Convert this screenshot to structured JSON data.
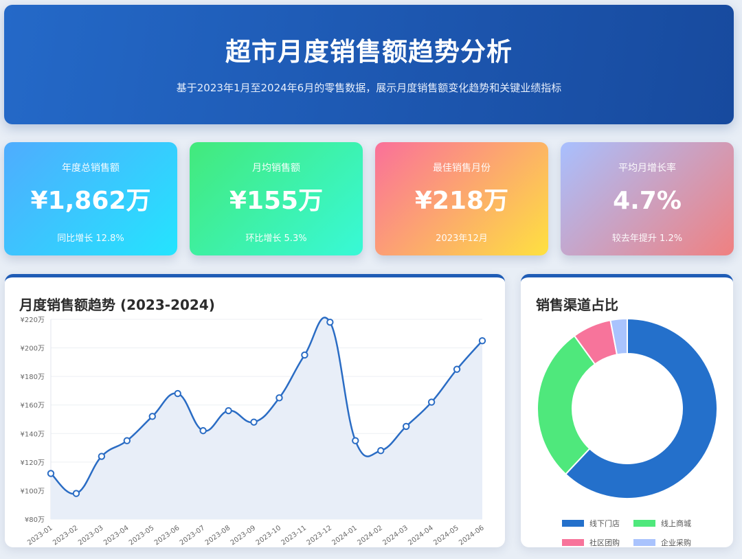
{
  "header": {
    "title": "超市月度销售额趋势分析",
    "subtitle": "基于2023年1月至2024年6月的零售数据，展示月度销售额变化趋势和关键业绩指标"
  },
  "cards": [
    {
      "label": "年度总销售额",
      "value": "¥1,862万",
      "sub": "同比增长 12.8%"
    },
    {
      "label": "月均销售额",
      "value": "¥155万",
      "sub": "环比增长 5.3%"
    },
    {
      "label": "最佳销售月份",
      "value": "¥218万",
      "sub": "2023年12月"
    },
    {
      "label": "平均月增长率",
      "value": "4.7%",
      "sub": "较去年提升 1.2%"
    }
  ],
  "line_panel": {
    "title": "月度销售额趋势 (2023-2024)"
  },
  "pie_panel": {
    "title": "销售渠道占比"
  },
  "chart_data": [
    {
      "type": "line",
      "title": "月度销售额趋势 (2023-2024)",
      "x": [
        "2023-01",
        "2023-02",
        "2023-03",
        "2023-04",
        "2023-05",
        "2023-06",
        "2023-07",
        "2023-08",
        "2023-09",
        "2023-10",
        "2023-11",
        "2023-12",
        "2024-01",
        "2024-02",
        "2024-03",
        "2024-04",
        "2024-05",
        "2024-06"
      ],
      "series": [
        {
          "values": [
            112,
            98,
            124,
            135,
            152,
            168,
            142,
            156,
            148,
            165,
            195,
            218,
            135,
            128,
            145,
            162,
            185,
            205
          ],
          "color": "#2a6cc4"
        }
      ],
      "ylim": [
        80,
        220
      ],
      "yticks": [
        "¥80万",
        "¥100万",
        "¥120万",
        "¥140万",
        "¥160万",
        "¥180万",
        "¥200万",
        "¥220万"
      ],
      "grid": true,
      "area_fill": "#e8eef8"
    },
    {
      "type": "pie",
      "title": "销售渠道占比",
      "donut": true,
      "labels": [
        "线下门店",
        "线上商城",
        "社区团购",
        "企业采购"
      ],
      "values": [
        62,
        28,
        7,
        3
      ],
      "colors": [
        "#2470cb",
        "#4fe87c",
        "#f7749b",
        "#a9c3fd"
      ],
      "legend": "bottom"
    }
  ]
}
